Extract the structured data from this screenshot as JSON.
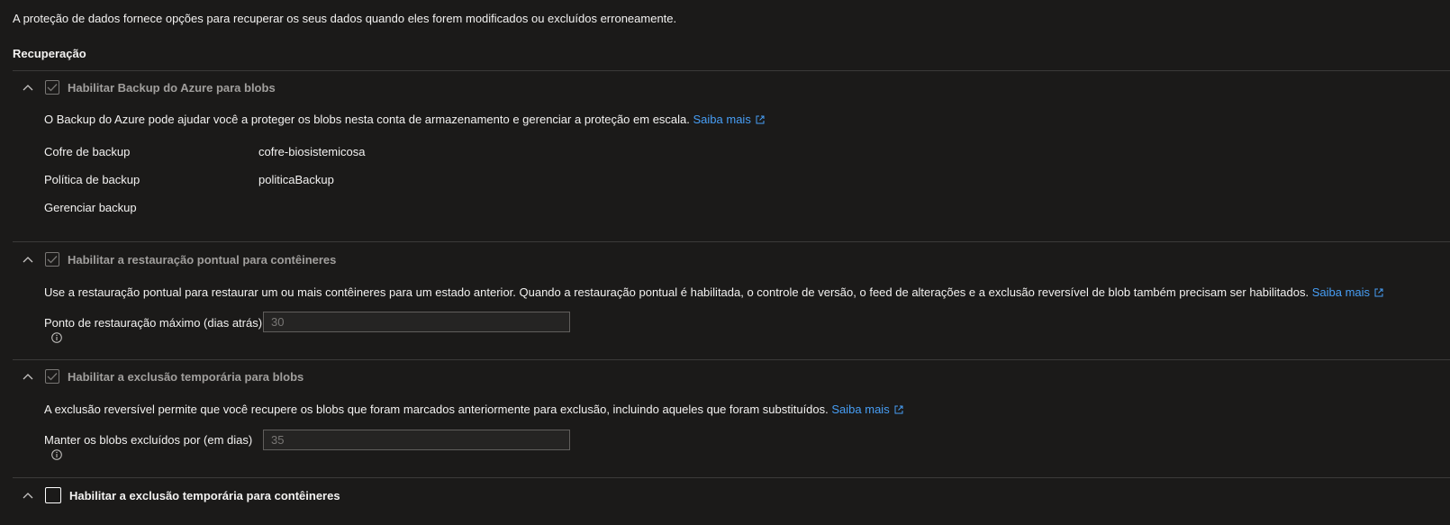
{
  "intro_text": "A proteção de dados fornece opções para recuperar os seus dados quando eles forem modificados ou excluídos erroneamente.",
  "section_title": "Recuperação",
  "groups": [
    {
      "label": "Habilitar Backup do Azure para blobs",
      "checked": true,
      "description": "O Backup do Azure pode ajudar você a proteger os blobs nesta conta de armazenamento e gerenciar a proteção em escala.",
      "learn_more": "Saiba mais",
      "fields": [
        {
          "label": "Cofre de backup",
          "value": "cofre-biosistemicosa"
        },
        {
          "label": "Política de backup",
          "value": "politicaBackup"
        }
      ],
      "action_link": "Gerenciar backup"
    },
    {
      "label": "Habilitar a restauração pontual para contêineres",
      "checked": true,
      "description": "Use a restauração pontual para restaurar um ou mais contêineres para um estado anterior. Quando a restauração pontual é habilitada, o controle de versão, o feed de alterações e a exclusão reversível de blob também precisam ser habilitados.",
      "learn_more": "Saiba mais",
      "input_label": "Ponto de restauração máximo (dias atrás)",
      "input_value": "30"
    },
    {
      "label": "Habilitar a exclusão temporária para blobs",
      "checked": true,
      "description": "A exclusão reversível permite que você recupere os blobs que foram marcados anteriormente para exclusão, incluindo aqueles que foram substituídos.",
      "learn_more": "Saiba mais",
      "input_label": "Manter os blobs excluídos por (em dias)",
      "input_value": "35"
    },
    {
      "label": "Habilitar a exclusão temporária para contêineres",
      "checked": false
    }
  ],
  "colors": {
    "background": "#1b1a19",
    "link": "#479ef5",
    "divider": "#3b3a39",
    "disabled_text": "#a19f9d"
  },
  "icons": [
    "chevron-up-icon",
    "checkmark-icon",
    "external-link-icon",
    "info-icon"
  ]
}
